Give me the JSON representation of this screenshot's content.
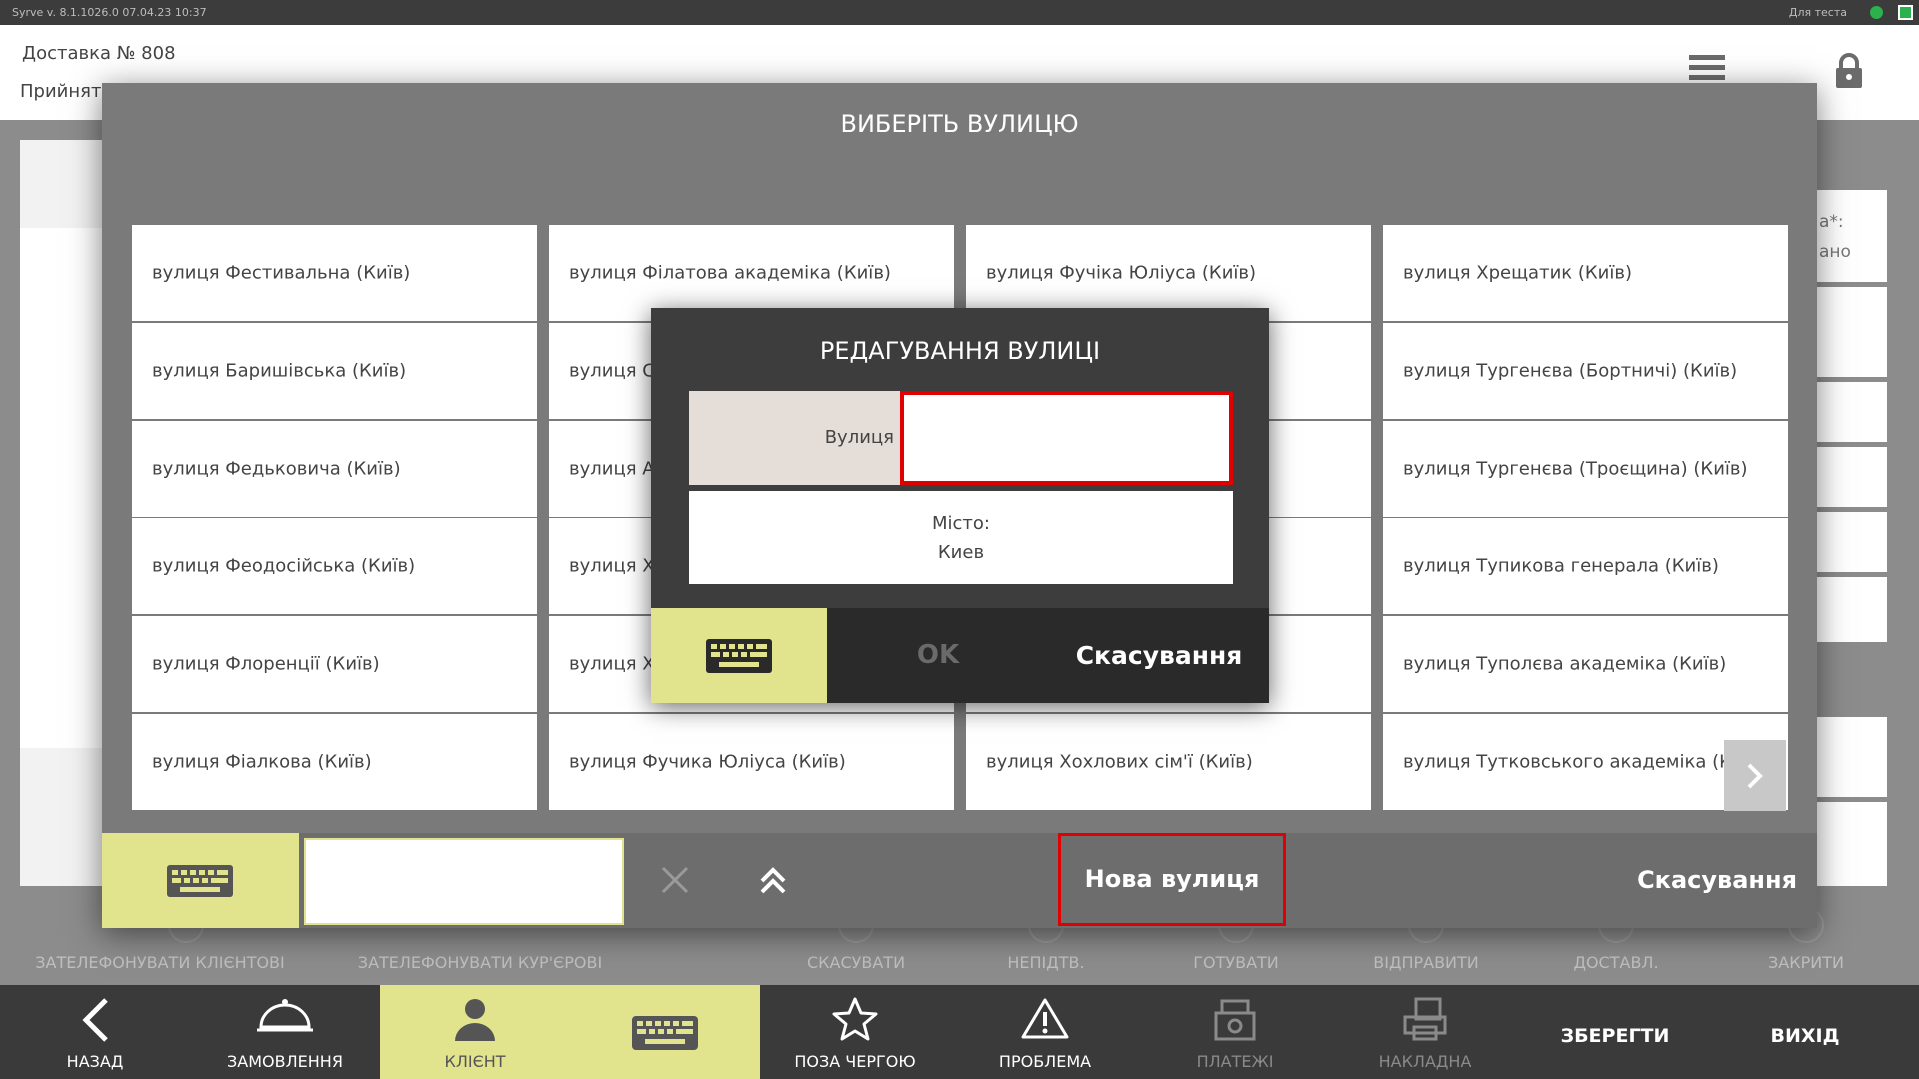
{
  "system_bar": {
    "version": "Syrve  v. 8.1.1026.0      07.04.23    10:37",
    "test_label": "Для теста"
  },
  "header": {
    "title": "Доставка № 808",
    "subtitle": "Прийнятий"
  },
  "background": {
    "right_label_1": "а*:",
    "right_label_2": "ано"
  },
  "actions": [
    "ЗАТЕЛЕФОНУВАТИ КЛІЄНТОВІ",
    "ЗАТЕЛЕФОНУВАТИ КУР'ЄРОВІ",
    "СКАСУВАТИ",
    "НЕПІДТВ.",
    "ГОТУВАТИ",
    "ВІДПРАВИТИ",
    "ДОСТАВЛ.",
    "ЗАКРИТИ"
  ],
  "nav": {
    "back": "НАЗАД",
    "order": "ЗАМОВЛЕННЯ",
    "client": "КЛІЄНТ",
    "priority": "ПОЗА ЧЕРГОЮ",
    "problem": "ПРОБЛЕМА",
    "payments": "ПЛАТЕЖІ",
    "invoice": "НАКЛАДНА",
    "save": "ЗБЕРЕГТИ",
    "exit": "ВИХІД"
  },
  "street_modal": {
    "title": "ВИБЕРІТЬ ВУЛИЦЮ",
    "streets": [
      [
        "вулиця Фестивальна (Київ)",
        "вулиця Філатова академіка (Київ)",
        "вулиця Фучіка Юліуса (Київ)",
        "вулиця Хрещатик (Київ)"
      ],
      [
        "вулиця Баришівська (Київ)",
        "вулиця С",
        "",
        "вулиця Тургенєва (Бортничі) (Київ)"
      ],
      [
        "вулиця Федьковича (Київ)",
        "вулиця А",
        "",
        "вулиця Тургенєва (Троєщина) (Київ)"
      ],
      [
        "вулиця Феодосійська (Київ)",
        "вулиця Х",
        "",
        "вулиця Тупикова генерала (Київ)"
      ],
      [
        "вулиця Флоренції (Київ)",
        "вулиця Х",
        "",
        "вулиця Туполєва академіка (Київ)"
      ],
      [
        "вулиця Фіалкова (Київ)",
        "вулиця Фучика Юліуса (Київ)",
        "вулиця Хохлових сім'ї (Київ)",
        "вулиця Тутковського академіка (Київ)"
      ]
    ],
    "search_value": "",
    "new_street": "Нова вулиця",
    "cancel": "Скасування"
  },
  "edit_modal": {
    "title": "РЕДАГУВАННЯ ВУЛИЦІ",
    "street_label": "Вулиця",
    "street_value": "",
    "city_label": "Місто:",
    "city_value": "Киев",
    "ok": "OK",
    "cancel": "Скасування"
  },
  "colors": {
    "accent": "#e1e38d",
    "highlight": "#e00000",
    "nav_bg": "#3a3a3a",
    "modal_bg": "#7a7a7a"
  }
}
